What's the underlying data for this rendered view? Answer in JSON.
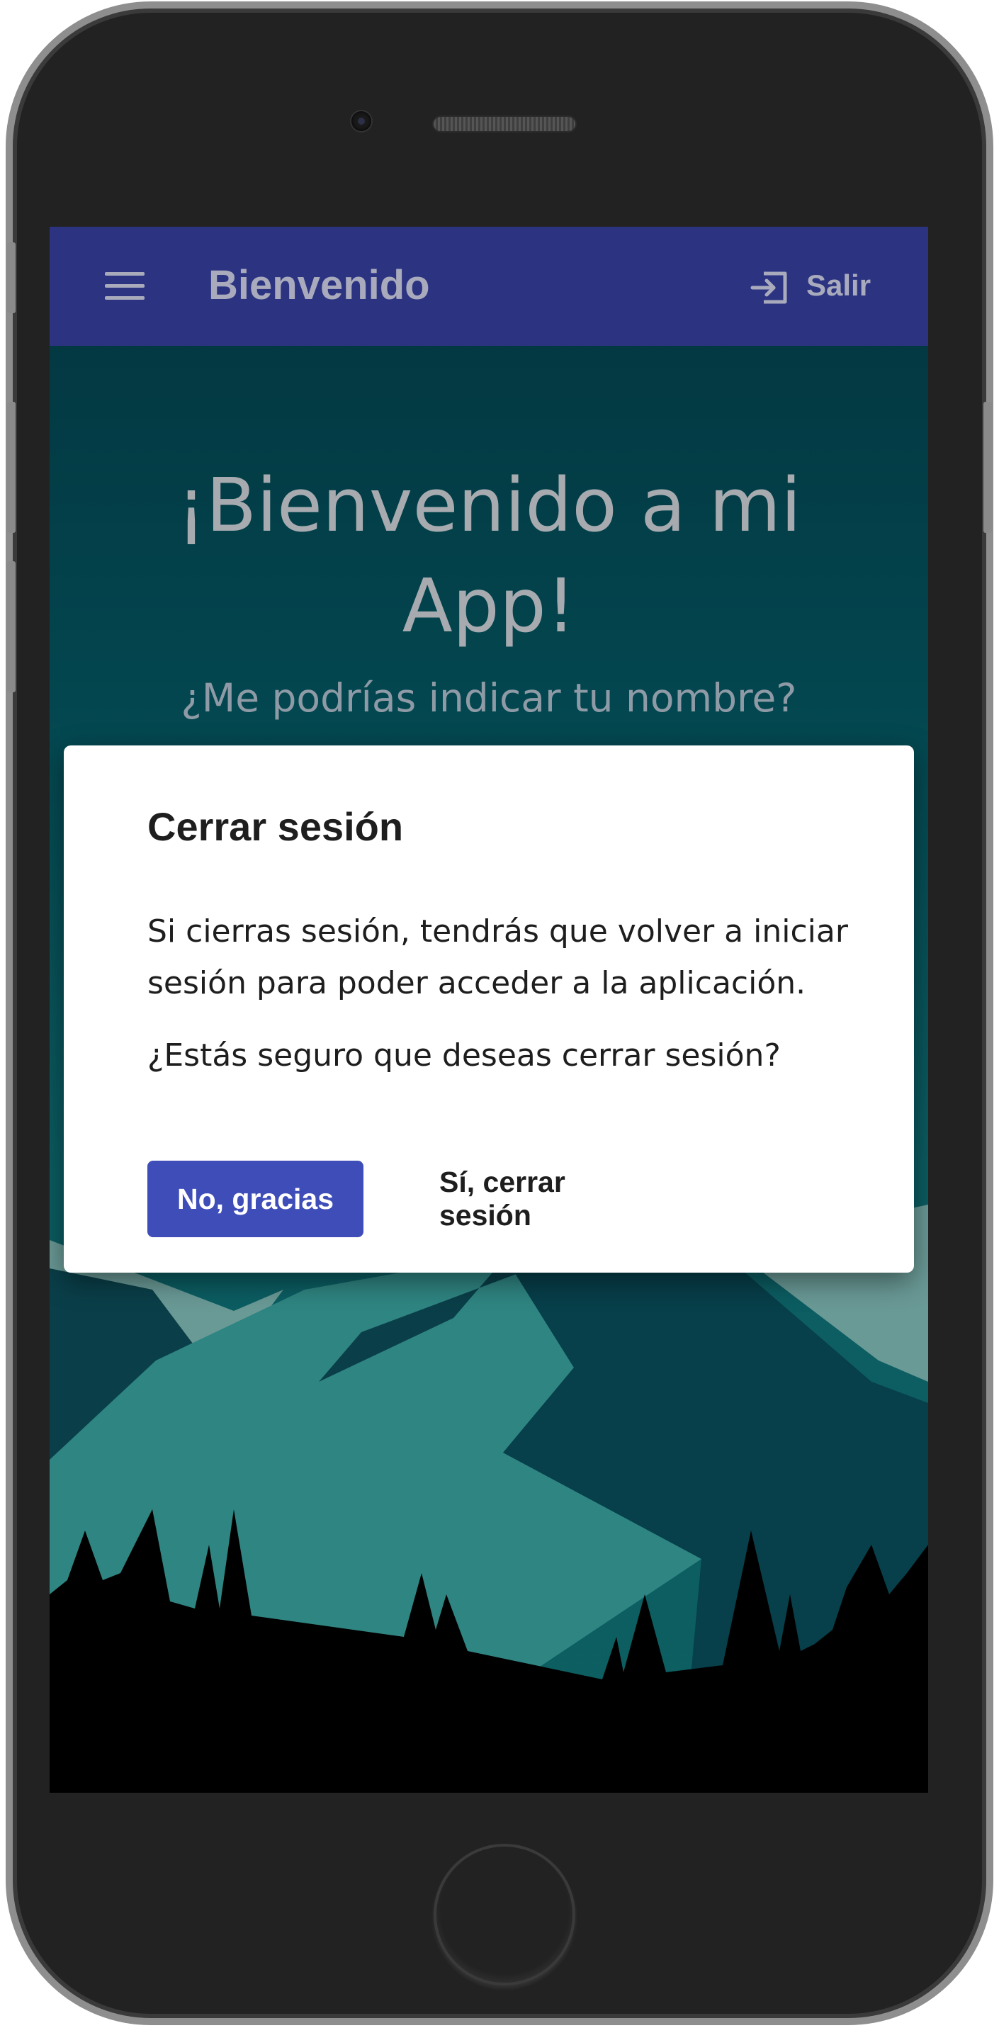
{
  "app_bar": {
    "menu_icon": "hamburger-menu-icon",
    "title": "Bienvenido",
    "logout_icon": "logout-icon",
    "logout_label": "Salir",
    "background": "#2c3482"
  },
  "hero": {
    "title": "¡Bienvenido a mi App!",
    "subtitle": "¿Me podrías indicar tu nombre?"
  },
  "dialog": {
    "title": "Cerrar sesión",
    "body": "Si cierras sesión, tendrás que volver a iniciar sesión para poder acceder a la aplicación.",
    "question": "¿Estás seguro que deseas cerrar sesión?",
    "cancel_label": "No, gracias",
    "confirm_label": "Sí, cerrar sesión",
    "accent_color": "#3f4db8"
  }
}
